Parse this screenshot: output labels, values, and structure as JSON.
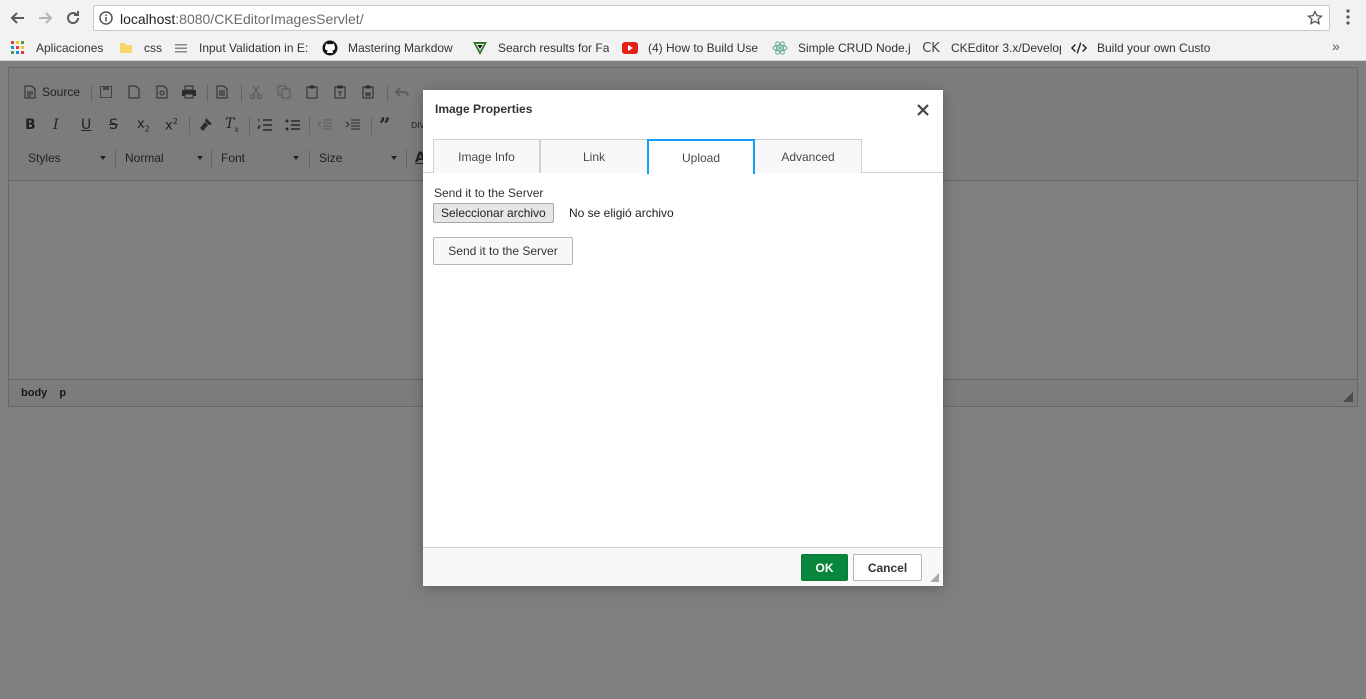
{
  "browser": {
    "url_host": "localhost",
    "url_path": ":8080/CKEditorImagesServlet/",
    "bookmarks": [
      {
        "label": "Aplicaciones",
        "icon": "apps-grid-icon"
      },
      {
        "label": "css",
        "icon": "folder-icon"
      },
      {
        "label": "Input Validation in E:",
        "icon": "page-lines-icon"
      },
      {
        "label": "Mastering Markdow",
        "icon": "github-icon"
      },
      {
        "label": "Search results for Fa",
        "icon": "v-logo-icon"
      },
      {
        "label": "(4) How to Build Use",
        "icon": "youtube-icon"
      },
      {
        "label": "Simple CRUD Node.j",
        "icon": "atom-icon"
      },
      {
        "label": "CKEditor 3.x/Develop",
        "icon": "ck-logo-icon"
      },
      {
        "label": "Build your own Custo",
        "icon": "code-icon"
      }
    ],
    "more_label": "»"
  },
  "editor": {
    "source_label": "Source",
    "styles_label": "Styles",
    "format_label": "Normal",
    "font_label": "Font",
    "size_label": "Size",
    "path": [
      "body",
      "p"
    ]
  },
  "dialog": {
    "title": "Image Properties",
    "tabs": [
      "Image Info",
      "Link",
      "Upload",
      "Advanced"
    ],
    "active_tab": "Upload",
    "field_label": "Send it to the Server",
    "file_button": "Seleccionar archivo",
    "file_status": "No se eligió archivo",
    "send_button": "Send it to the Server",
    "ok_button": "OK",
    "cancel_button": "Cancel"
  },
  "colors": {
    "ok_green": "#09863e",
    "active_tab_border": "#139ff7",
    "overlay": "rgba(0,0,0,0.5)"
  }
}
